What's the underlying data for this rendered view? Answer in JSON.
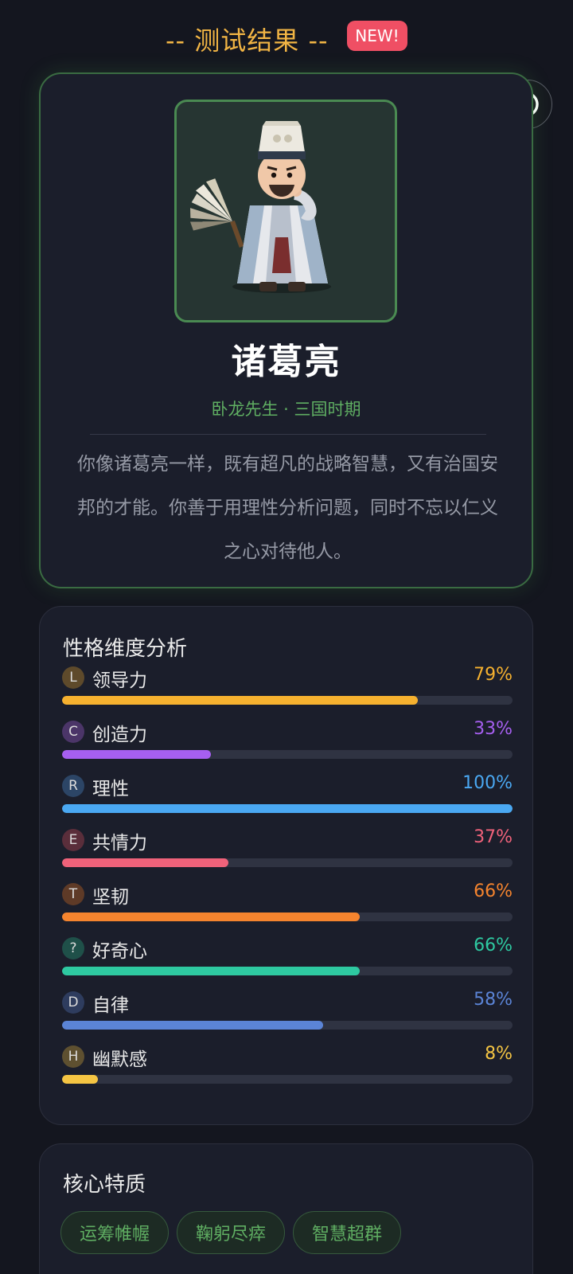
{
  "header": {
    "title": "-- 测试结果 --",
    "badge": "NEW!",
    "title_color": "#f2b544",
    "badge_color": "#ef4f64"
  },
  "capsule_menu": {
    "more_icon": "more-dots-icon",
    "close_icon": "target-circle-icon"
  },
  "result": {
    "portrait_icon": "zhuge-liang-portrait",
    "name": "诸葛亮",
    "subtitle": "卧龙先生 · 三国时期",
    "description": "你像诸葛亮一样，既有超凡的战略智慧，又有治国安邦的才能。你善于用理性分析问题，同时不忘以仁义之心对待他人。",
    "accent_color": "#5fae62"
  },
  "dimensions": {
    "title": "性格维度分析",
    "items": [
      {
        "letter": "L",
        "label": "领导力",
        "percent_text": "79%",
        "value": 79,
        "color": "#f6b12f",
        "badge_bg": "#5e4a2b"
      },
      {
        "letter": "C",
        "label": "创造力",
        "percent_text": "33%",
        "value": 33,
        "color": "#a65ff0",
        "badge_bg": "#4b3568"
      },
      {
        "letter": "R",
        "label": "理性",
        "percent_text": "100%",
        "value": 100,
        "color": "#4aa8f2",
        "badge_bg": "#2c4566"
      },
      {
        "letter": "E",
        "label": "共情力",
        "percent_text": "37%",
        "value": 37,
        "color": "#f0627a",
        "badge_bg": "#5a2e3b"
      },
      {
        "letter": "T",
        "label": "坚韧",
        "percent_text": "66%",
        "value": 66,
        "color": "#f5842e",
        "badge_bg": "#5e3a27"
      },
      {
        "letter": "?",
        "label": "好奇心",
        "percent_text": "66%",
        "value": 66,
        "color": "#2ec9a1",
        "badge_bg": "#1f5049"
      },
      {
        "letter": "D",
        "label": "自律",
        "percent_text": "58%",
        "value": 58,
        "color": "#5b84d6",
        "badge_bg": "#2e3c5e"
      },
      {
        "letter": "H",
        "label": "幽默感",
        "percent_text": "8%",
        "value": 8,
        "color": "#f5c543",
        "badge_bg": "#5e5030"
      }
    ]
  },
  "traits": {
    "title": "核心特质",
    "tags": [
      "运筹帷幄",
      "鞠躬尽瘁",
      "智慧超群"
    ]
  }
}
